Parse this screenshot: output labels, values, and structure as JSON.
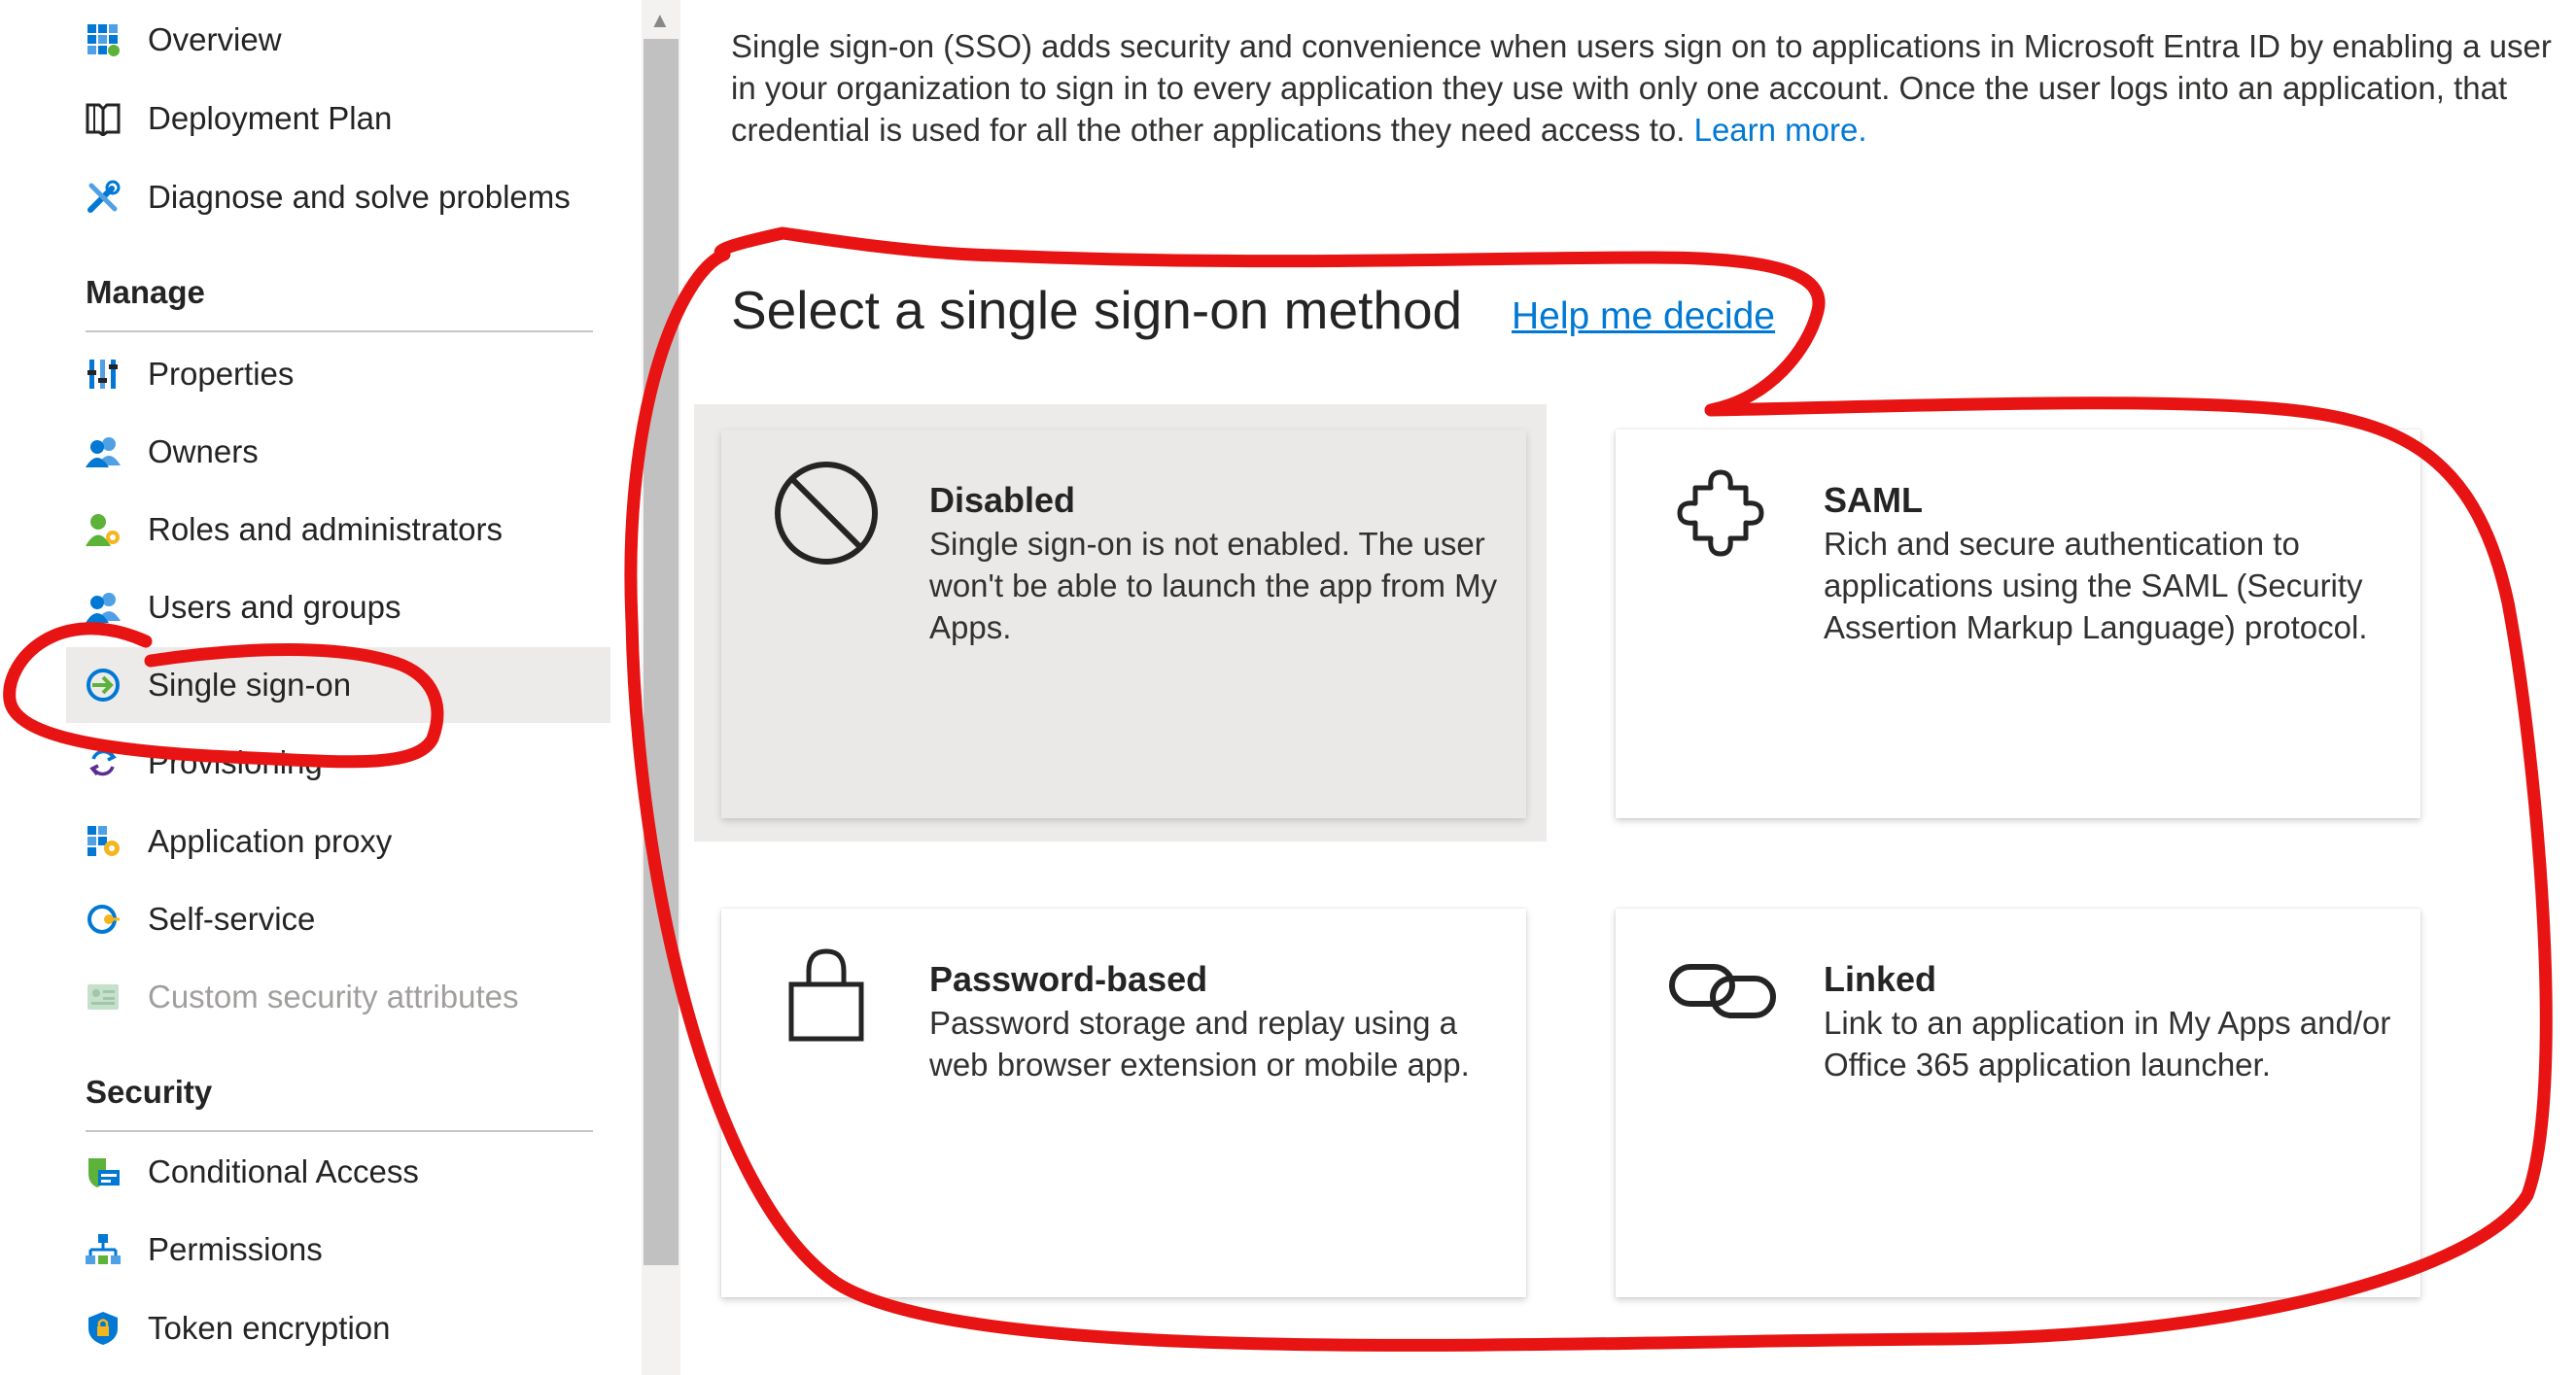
{
  "sidebar": {
    "items_top": [
      {
        "label": "Overview",
        "icon": "overview-icon"
      },
      {
        "label": "Deployment Plan",
        "icon": "book-icon"
      },
      {
        "label": "Diagnose and solve problems",
        "icon": "wrench-icon"
      }
    ],
    "manage_header": "Manage",
    "manage_items": [
      {
        "label": "Properties",
        "icon": "properties-icon"
      },
      {
        "label": "Owners",
        "icon": "owners-icon"
      },
      {
        "label": "Roles and administrators",
        "icon": "roles-icon"
      },
      {
        "label": "Users and groups",
        "icon": "users-icon"
      },
      {
        "label": "Single sign-on",
        "icon": "sso-icon"
      },
      {
        "label": "Provisioning",
        "icon": "provisioning-icon"
      },
      {
        "label": "Application proxy",
        "icon": "app-proxy-icon"
      },
      {
        "label": "Self-service",
        "icon": "self-service-icon"
      },
      {
        "label": "Custom security attributes",
        "icon": "custom-attributes-icon"
      }
    ],
    "security_header": "Security",
    "security_items": [
      {
        "label": "Conditional Access",
        "icon": "conditional-access-icon"
      },
      {
        "label": "Permissions",
        "icon": "permissions-icon"
      },
      {
        "label": "Token encryption",
        "icon": "shield-icon"
      }
    ]
  },
  "main": {
    "intro_text": "Single sign-on (SSO) adds security and convenience when users sign on to applications in Microsoft Entra ID by enabling a user in your organization to sign in to every application they use with only one account. Once the user logs into an application, that credential is used for all the other applications they need access to.",
    "learn_more": "Learn more.",
    "method_title": "Select a single sign-on method",
    "help_link": "Help me decide",
    "cards": [
      {
        "title": "Disabled",
        "desc": "Single sign-on is not enabled. The user won't be able to launch the app from My Apps.",
        "icon": "disabled-icon"
      },
      {
        "title": "SAML",
        "desc": "Rich and secure authentication to applications using the SAML (Security Assertion Markup Language) protocol.",
        "icon": "puzzle-icon"
      },
      {
        "title": "Password-based",
        "desc": "Password storage and replay using a web browser extension or mobile app.",
        "icon": "lock-icon"
      },
      {
        "title": "Linked",
        "desc": "Link to an application in My Apps and/or Office 365 application launcher.",
        "icon": "link-icon"
      }
    ]
  },
  "colors": {
    "accent": "#0078d4",
    "annotation": "#e81313",
    "selected_bg": "#edebe9"
  }
}
